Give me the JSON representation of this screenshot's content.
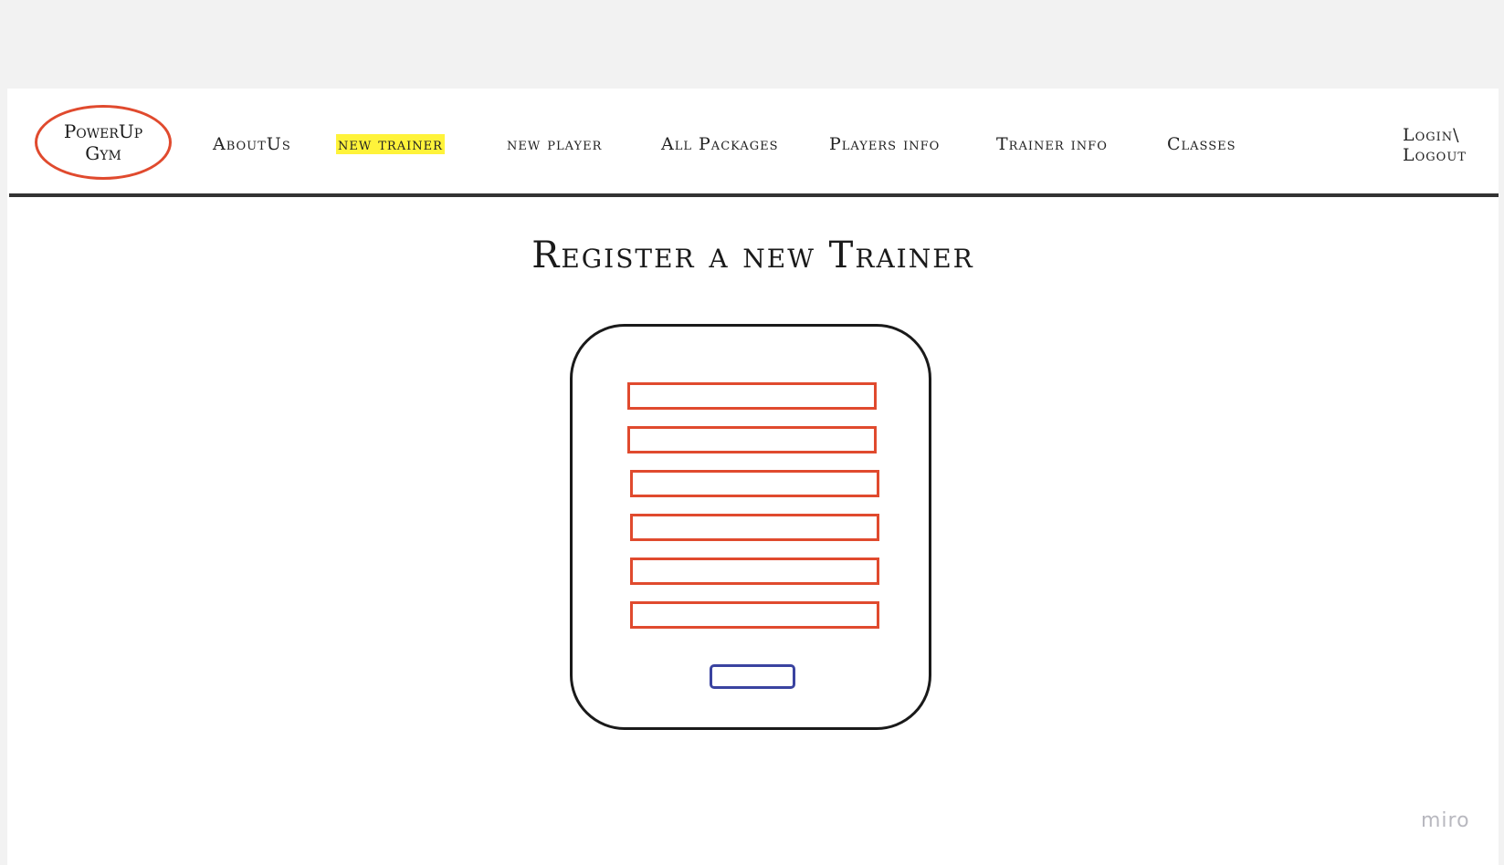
{
  "logo": {
    "line1": "PowerUp",
    "line2": "Gym"
  },
  "nav": {
    "items": [
      {
        "label": "AboutUs"
      },
      {
        "label": "new trainer"
      },
      {
        "label": "new player"
      },
      {
        "label": "All Packages"
      },
      {
        "label": "Players info"
      },
      {
        "label": "Trainer info"
      },
      {
        "label": "Classes"
      }
    ],
    "login_line1": "Login\\",
    "login_line2": "Logout"
  },
  "main": {
    "title": "Register a new Trainer"
  },
  "form": {
    "field_count": 6
  },
  "watermark": "miro",
  "colors": {
    "field_border": "#e04a2e",
    "button_border": "#3a43a0",
    "highlight": "#fff33a"
  }
}
